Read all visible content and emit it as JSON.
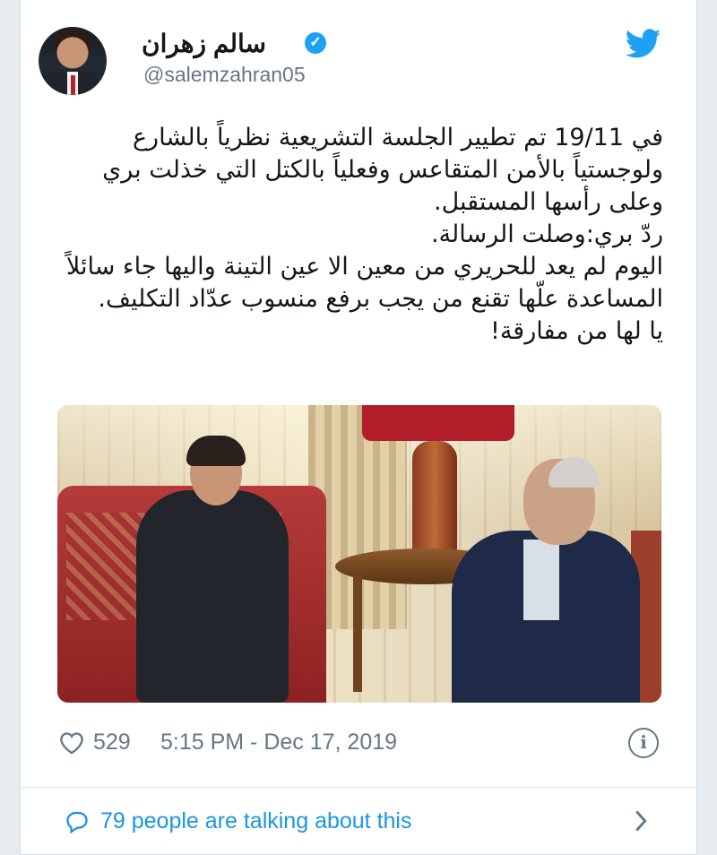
{
  "author": {
    "display_name": "سالم زهران",
    "handle": "@salemzahran05",
    "verified": true,
    "avatar_icon": "profile-photo"
  },
  "brand": {
    "logo_icon": "twitter-bird-icon",
    "accent": "#1da1f2"
  },
  "tweet": {
    "lines": [
      "في 19/11 تم تطيير الجلسة التشريعية نظرياً بالشارع",
      "ولوجستياً بالأمن المتقاعس وفعلياً بالكتل التي خذلت بري",
      "وعلى رأسها المستقبل.",
      "ردّ بري:وصلت الرسالة.",
      "اليوم لم يعد للحريري من معين الا عين التينة واليها جاء سائلاً",
      "المساعدة علّها تقنع من يجب برفع منسوب عدّاد التكليف.",
      "يا لها من مفارقة!"
    ]
  },
  "meta": {
    "like_icon": "heart-icon",
    "like_count": "529",
    "timestamp": "5:15 PM - Dec 17, 2019",
    "info_icon": "info-icon"
  },
  "conversation": {
    "icon": "speech-bubble-icon",
    "label": "79 people are talking about this",
    "chevron_icon": "chevron-right-icon"
  },
  "colors": {
    "text_primary": "#14171a",
    "text_secondary": "#657786",
    "link": "#1b95e0"
  }
}
